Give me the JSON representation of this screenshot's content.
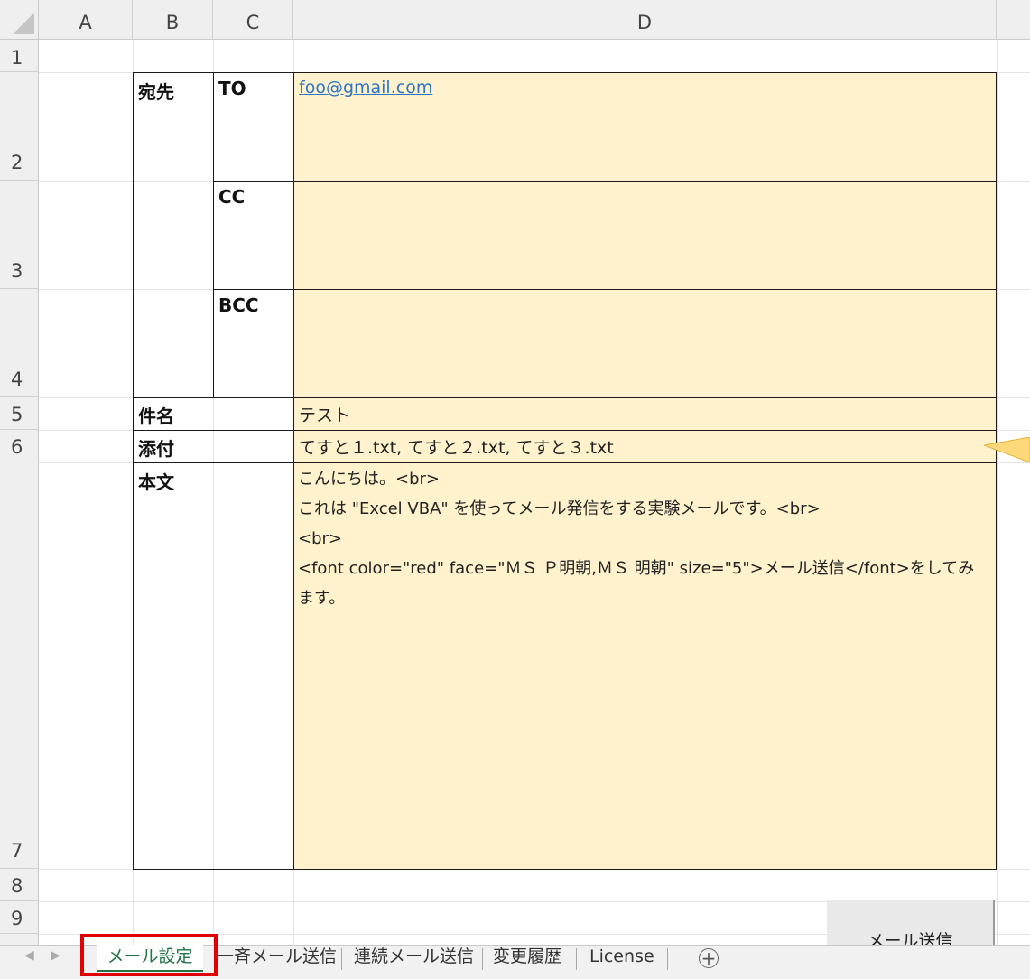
{
  "columns": [
    "A",
    "B",
    "C",
    "D"
  ],
  "rows": [
    "1",
    "2",
    "3",
    "4",
    "5",
    "6",
    "7",
    "8",
    "9"
  ],
  "recipients": {
    "label": "宛先",
    "to_label": "TO",
    "to_value": "foo@gmail.com",
    "cc_label": "CC",
    "cc_value": "",
    "bcc_label": "BCC",
    "bcc_value": ""
  },
  "subject": {
    "label": "件名",
    "value": "テスト"
  },
  "attachment": {
    "label": "添付",
    "value": "てすと１.txt, てすと２.txt, てすと３.txt"
  },
  "body": {
    "label": "本文",
    "lines": [
      "こんにちは。<br>",
      "これは \"Excel VBA\" を使ってメール発信をする実験メールです。<br>",
      "<br>",
      "<font color=\"red\" face=\"ＭＳ Ｐ明朝,ＭＳ 明朝\" size=\"5\">メール送信</font>をしてみます。"
    ]
  },
  "send_button": {
    "label": "メール送信"
  },
  "tabs": [
    "メール設定",
    "一斉メール送信",
    "連続メール送信",
    "変更履歴",
    "License"
  ],
  "active_tab": "メール設定",
  "add_sheet_icon": "plus-circle-icon",
  "colors": {
    "input_fill": "#fff2cc",
    "active_tab": "#217346",
    "highlight": "#e00000",
    "link": "#2e75c5"
  }
}
